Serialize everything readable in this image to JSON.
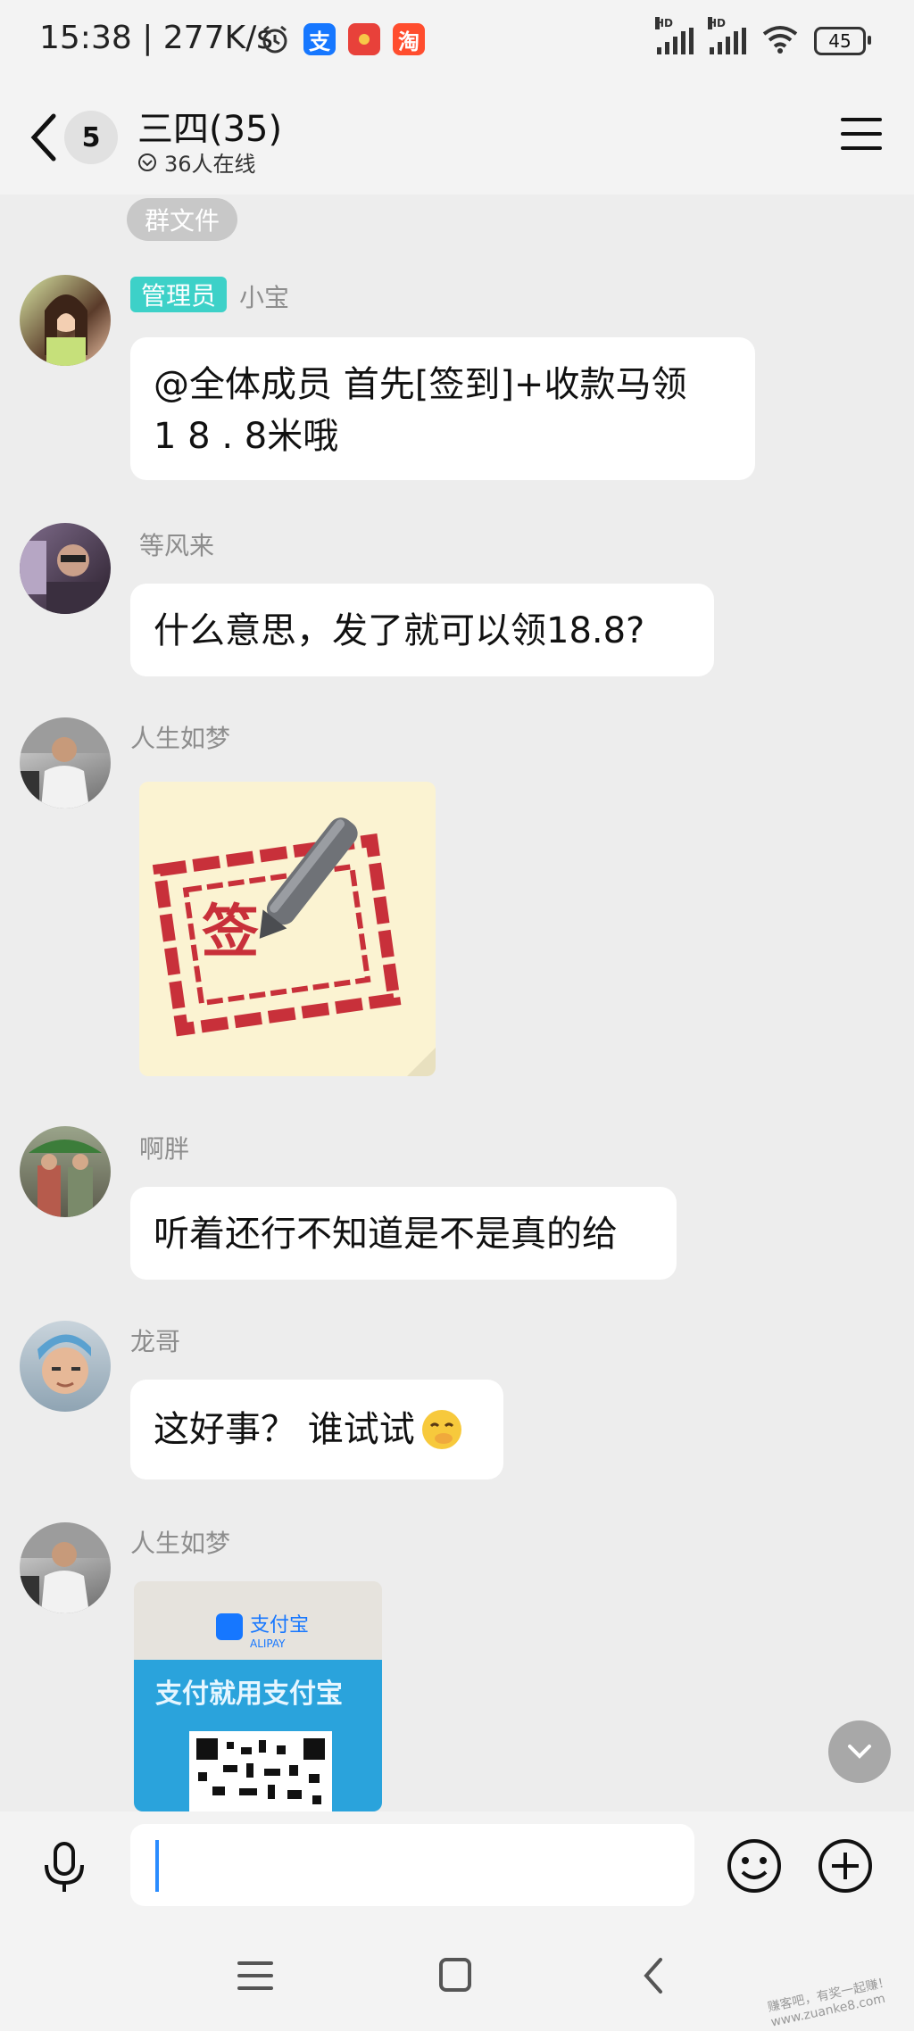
{
  "status_bar": {
    "time": "15:38 | 277K/s",
    "battery": "45",
    "app_icons": [
      "alarm-icon",
      "alipay-icon",
      "red-packet-icon",
      "taobao-icon"
    ],
    "alipay_char": "支",
    "taobao_char": "淘",
    "hd_label": "HD"
  },
  "header": {
    "unread_count": "5",
    "title": "三四(35)",
    "online_status": "36人在线"
  },
  "pinned_chip": "群文件",
  "messages": [
    {
      "sender": "小宝",
      "role": "管理员",
      "text": "@全体成员 首先[签到]+收款马领\n1 8 . 8米哦"
    },
    {
      "sender": "等风来",
      "text": "什么意思，发了就可以领18.8?"
    },
    {
      "sender": "人生如梦",
      "image": "sign-in-sticker",
      "sticker_char": "签"
    },
    {
      "sender": "啊胖",
      "text": "听着还行不知道是不是真的给"
    },
    {
      "sender": "龙哥",
      "text": "这好事？ 谁试试"
    },
    {
      "sender": "人生如梦",
      "image": "alipay-qr-photo",
      "alipay_brand": "支付宝",
      "alipay_en": "ALIPAY",
      "alipay_slogan": "支付就用支付宝"
    }
  ],
  "input": {
    "value": "",
    "placeholder": ""
  },
  "colors": {
    "admin_tag": "#3dd1c8",
    "background": "#ededed",
    "bubble": "#ffffff",
    "cursor": "#2a8cff"
  },
  "watermark": "赚客吧，有奖一起赚！ www.zuanke8.com"
}
